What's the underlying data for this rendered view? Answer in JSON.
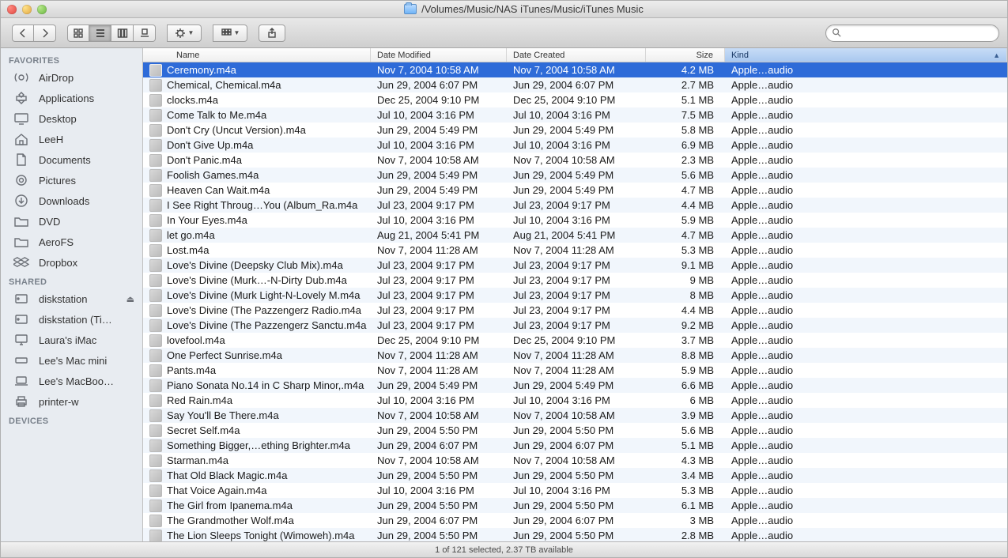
{
  "window": {
    "title_path": "/Volumes/Music/NAS iTunes/Music/iTunes Music"
  },
  "search": {
    "placeholder": ""
  },
  "columns": {
    "name": "Name",
    "modified": "Date Modified",
    "created": "Date Created",
    "size": "Size",
    "kind": "Kind"
  },
  "sidebar": {
    "favorites_label": "FAVORITES",
    "shared_label": "SHARED",
    "devices_label": "DEVICES",
    "favorites": [
      {
        "label": "AirDrop",
        "icon": "airdrop"
      },
      {
        "label": "Applications",
        "icon": "apps"
      },
      {
        "label": "Desktop",
        "icon": "desktop"
      },
      {
        "label": "LeeH",
        "icon": "home"
      },
      {
        "label": "Documents",
        "icon": "documents"
      },
      {
        "label": "Pictures",
        "icon": "pictures"
      },
      {
        "label": "Downloads",
        "icon": "downloads"
      },
      {
        "label": "DVD",
        "icon": "folder"
      },
      {
        "label": "AeroFS",
        "icon": "folder"
      },
      {
        "label": "Dropbox",
        "icon": "dropbox"
      }
    ],
    "shared": [
      {
        "label": "diskstation",
        "icon": "server",
        "eject": true
      },
      {
        "label": "diskstation (Ti…",
        "icon": "server"
      },
      {
        "label": "Laura's iMac",
        "icon": "imac"
      },
      {
        "label": "Lee's Mac mini",
        "icon": "macmini"
      },
      {
        "label": "Lee's MacBoo…",
        "icon": "laptop"
      },
      {
        "label": "printer-w",
        "icon": "printer"
      }
    ]
  },
  "files": [
    {
      "name": "Ceremony.m4a",
      "modified": "Nov 7, 2004 10:58 AM",
      "created": "Nov 7, 2004 10:58 AM",
      "size": "4.2 MB",
      "kind": "Apple…audio",
      "selected": true
    },
    {
      "name": "Chemical, Chemical.m4a",
      "modified": "Jun 29, 2004 6:07 PM",
      "created": "Jun 29, 2004 6:07 PM",
      "size": "2.7 MB",
      "kind": "Apple…audio"
    },
    {
      "name": "clocks.m4a",
      "modified": "Dec 25, 2004 9:10 PM",
      "created": "Dec 25, 2004 9:10 PM",
      "size": "5.1 MB",
      "kind": "Apple…audio"
    },
    {
      "name": "Come Talk to Me.m4a",
      "modified": "Jul 10, 2004 3:16 PM",
      "created": "Jul 10, 2004 3:16 PM",
      "size": "7.5 MB",
      "kind": "Apple…audio"
    },
    {
      "name": "Don't Cry (Uncut Version).m4a",
      "modified": "Jun 29, 2004 5:49 PM",
      "created": "Jun 29, 2004 5:49 PM",
      "size": "5.8 MB",
      "kind": "Apple…audio"
    },
    {
      "name": "Don't Give Up.m4a",
      "modified": "Jul 10, 2004 3:16 PM",
      "created": "Jul 10, 2004 3:16 PM",
      "size": "6.9 MB",
      "kind": "Apple…audio"
    },
    {
      "name": "Don't Panic.m4a",
      "modified": "Nov 7, 2004 10:58 AM",
      "created": "Nov 7, 2004 10:58 AM",
      "size": "2.3 MB",
      "kind": "Apple…audio"
    },
    {
      "name": "Foolish Games.m4a",
      "modified": "Jun 29, 2004 5:49 PM",
      "created": "Jun 29, 2004 5:49 PM",
      "size": "5.6 MB",
      "kind": "Apple…audio"
    },
    {
      "name": "Heaven Can Wait.m4a",
      "modified": "Jun 29, 2004 5:49 PM",
      "created": "Jun 29, 2004 5:49 PM",
      "size": "4.7 MB",
      "kind": "Apple…audio"
    },
    {
      "name": "I See Right Throug…You (Album_Ra.m4a",
      "modified": "Jul 23, 2004 9:17 PM",
      "created": "Jul 23, 2004 9:17 PM",
      "size": "4.4 MB",
      "kind": "Apple…audio"
    },
    {
      "name": "In Your Eyes.m4a",
      "modified": "Jul 10, 2004 3:16 PM",
      "created": "Jul 10, 2004 3:16 PM",
      "size": "5.9 MB",
      "kind": "Apple…audio"
    },
    {
      "name": "let go.m4a",
      "modified": "Aug 21, 2004 5:41 PM",
      "created": "Aug 21, 2004 5:41 PM",
      "size": "4.7 MB",
      "kind": "Apple…audio"
    },
    {
      "name": "Lost.m4a",
      "modified": "Nov 7, 2004 11:28 AM",
      "created": "Nov 7, 2004 11:28 AM",
      "size": "5.3 MB",
      "kind": "Apple…audio"
    },
    {
      "name": "Love's Divine (Deepsky Club Mix).m4a",
      "modified": "Jul 23, 2004 9:17 PM",
      "created": "Jul 23, 2004 9:17 PM",
      "size": "9.1 MB",
      "kind": "Apple…audio"
    },
    {
      "name": "Love's Divine (Murk…-N-Dirty Dub.m4a",
      "modified": "Jul 23, 2004 9:17 PM",
      "created": "Jul 23, 2004 9:17 PM",
      "size": "9 MB",
      "kind": "Apple…audio"
    },
    {
      "name": "Love's Divine (Murk Light-N-Lovely M.m4a",
      "modified": "Jul 23, 2004 9:17 PM",
      "created": "Jul 23, 2004 9:17 PM",
      "size": "8 MB",
      "kind": "Apple…audio"
    },
    {
      "name": "Love's Divine (The Pazzengerz Radio.m4a",
      "modified": "Jul 23, 2004 9:17 PM",
      "created": "Jul 23, 2004 9:17 PM",
      "size": "4.4 MB",
      "kind": "Apple…audio"
    },
    {
      "name": "Love's Divine (The Pazzengerz Sanctu.m4a",
      "modified": "Jul 23, 2004 9:17 PM",
      "created": "Jul 23, 2004 9:17 PM",
      "size": "9.2 MB",
      "kind": "Apple…audio"
    },
    {
      "name": "lovefool.m4a",
      "modified": "Dec 25, 2004 9:10 PM",
      "created": "Dec 25, 2004 9:10 PM",
      "size": "3.7 MB",
      "kind": "Apple…audio"
    },
    {
      "name": "One Perfect Sunrise.m4a",
      "modified": "Nov 7, 2004 11:28 AM",
      "created": "Nov 7, 2004 11:28 AM",
      "size": "8.8 MB",
      "kind": "Apple…audio"
    },
    {
      "name": "Pants.m4a",
      "modified": "Nov 7, 2004 11:28 AM",
      "created": "Nov 7, 2004 11:28 AM",
      "size": "5.9 MB",
      "kind": "Apple…audio"
    },
    {
      "name": "Piano Sonata No.14 in C Sharp Minor,.m4a",
      "modified": "Jun 29, 2004 5:49 PM",
      "created": "Jun 29, 2004 5:49 PM",
      "size": "6.6 MB",
      "kind": "Apple…audio"
    },
    {
      "name": "Red Rain.m4a",
      "modified": "Jul 10, 2004 3:16 PM",
      "created": "Jul 10, 2004 3:16 PM",
      "size": "6 MB",
      "kind": "Apple…audio"
    },
    {
      "name": "Say You'll Be There.m4a",
      "modified": "Nov 7, 2004 10:58 AM",
      "created": "Nov 7, 2004 10:58 AM",
      "size": "3.9 MB",
      "kind": "Apple…audio"
    },
    {
      "name": "Secret Self.m4a",
      "modified": "Jun 29, 2004 5:50 PM",
      "created": "Jun 29, 2004 5:50 PM",
      "size": "5.6 MB",
      "kind": "Apple…audio"
    },
    {
      "name": "Something Bigger,…ething Brighter.m4a",
      "modified": "Jun 29, 2004 6:07 PM",
      "created": "Jun 29, 2004 6:07 PM",
      "size": "5.1 MB",
      "kind": "Apple…audio"
    },
    {
      "name": "Starman.m4a",
      "modified": "Nov 7, 2004 10:58 AM",
      "created": "Nov 7, 2004 10:58 AM",
      "size": "4.3 MB",
      "kind": "Apple…audio"
    },
    {
      "name": "That Old Black Magic.m4a",
      "modified": "Jun 29, 2004 5:50 PM",
      "created": "Jun 29, 2004 5:50 PM",
      "size": "3.4 MB",
      "kind": "Apple…audio"
    },
    {
      "name": "That Voice Again.m4a",
      "modified": "Jul 10, 2004 3:16 PM",
      "created": "Jul 10, 2004 3:16 PM",
      "size": "5.3 MB",
      "kind": "Apple…audio"
    },
    {
      "name": "The Girl from Ipanema.m4a",
      "modified": "Jun 29, 2004 5:50 PM",
      "created": "Jun 29, 2004 5:50 PM",
      "size": "6.1 MB",
      "kind": "Apple…audio"
    },
    {
      "name": "The Grandmother Wolf.m4a",
      "modified": "Jun 29, 2004 6:07 PM",
      "created": "Jun 29, 2004 6:07 PM",
      "size": "3 MB",
      "kind": "Apple…audio"
    },
    {
      "name": "The Lion Sleeps Tonight (Wimoweh).m4a",
      "modified": "Jun 29, 2004 5:50 PM",
      "created": "Jun 29, 2004 5:50 PM",
      "size": "2.8 MB",
      "kind": "Apple…audio"
    }
  ],
  "status": "1 of 121 selected, 2.37 TB available"
}
